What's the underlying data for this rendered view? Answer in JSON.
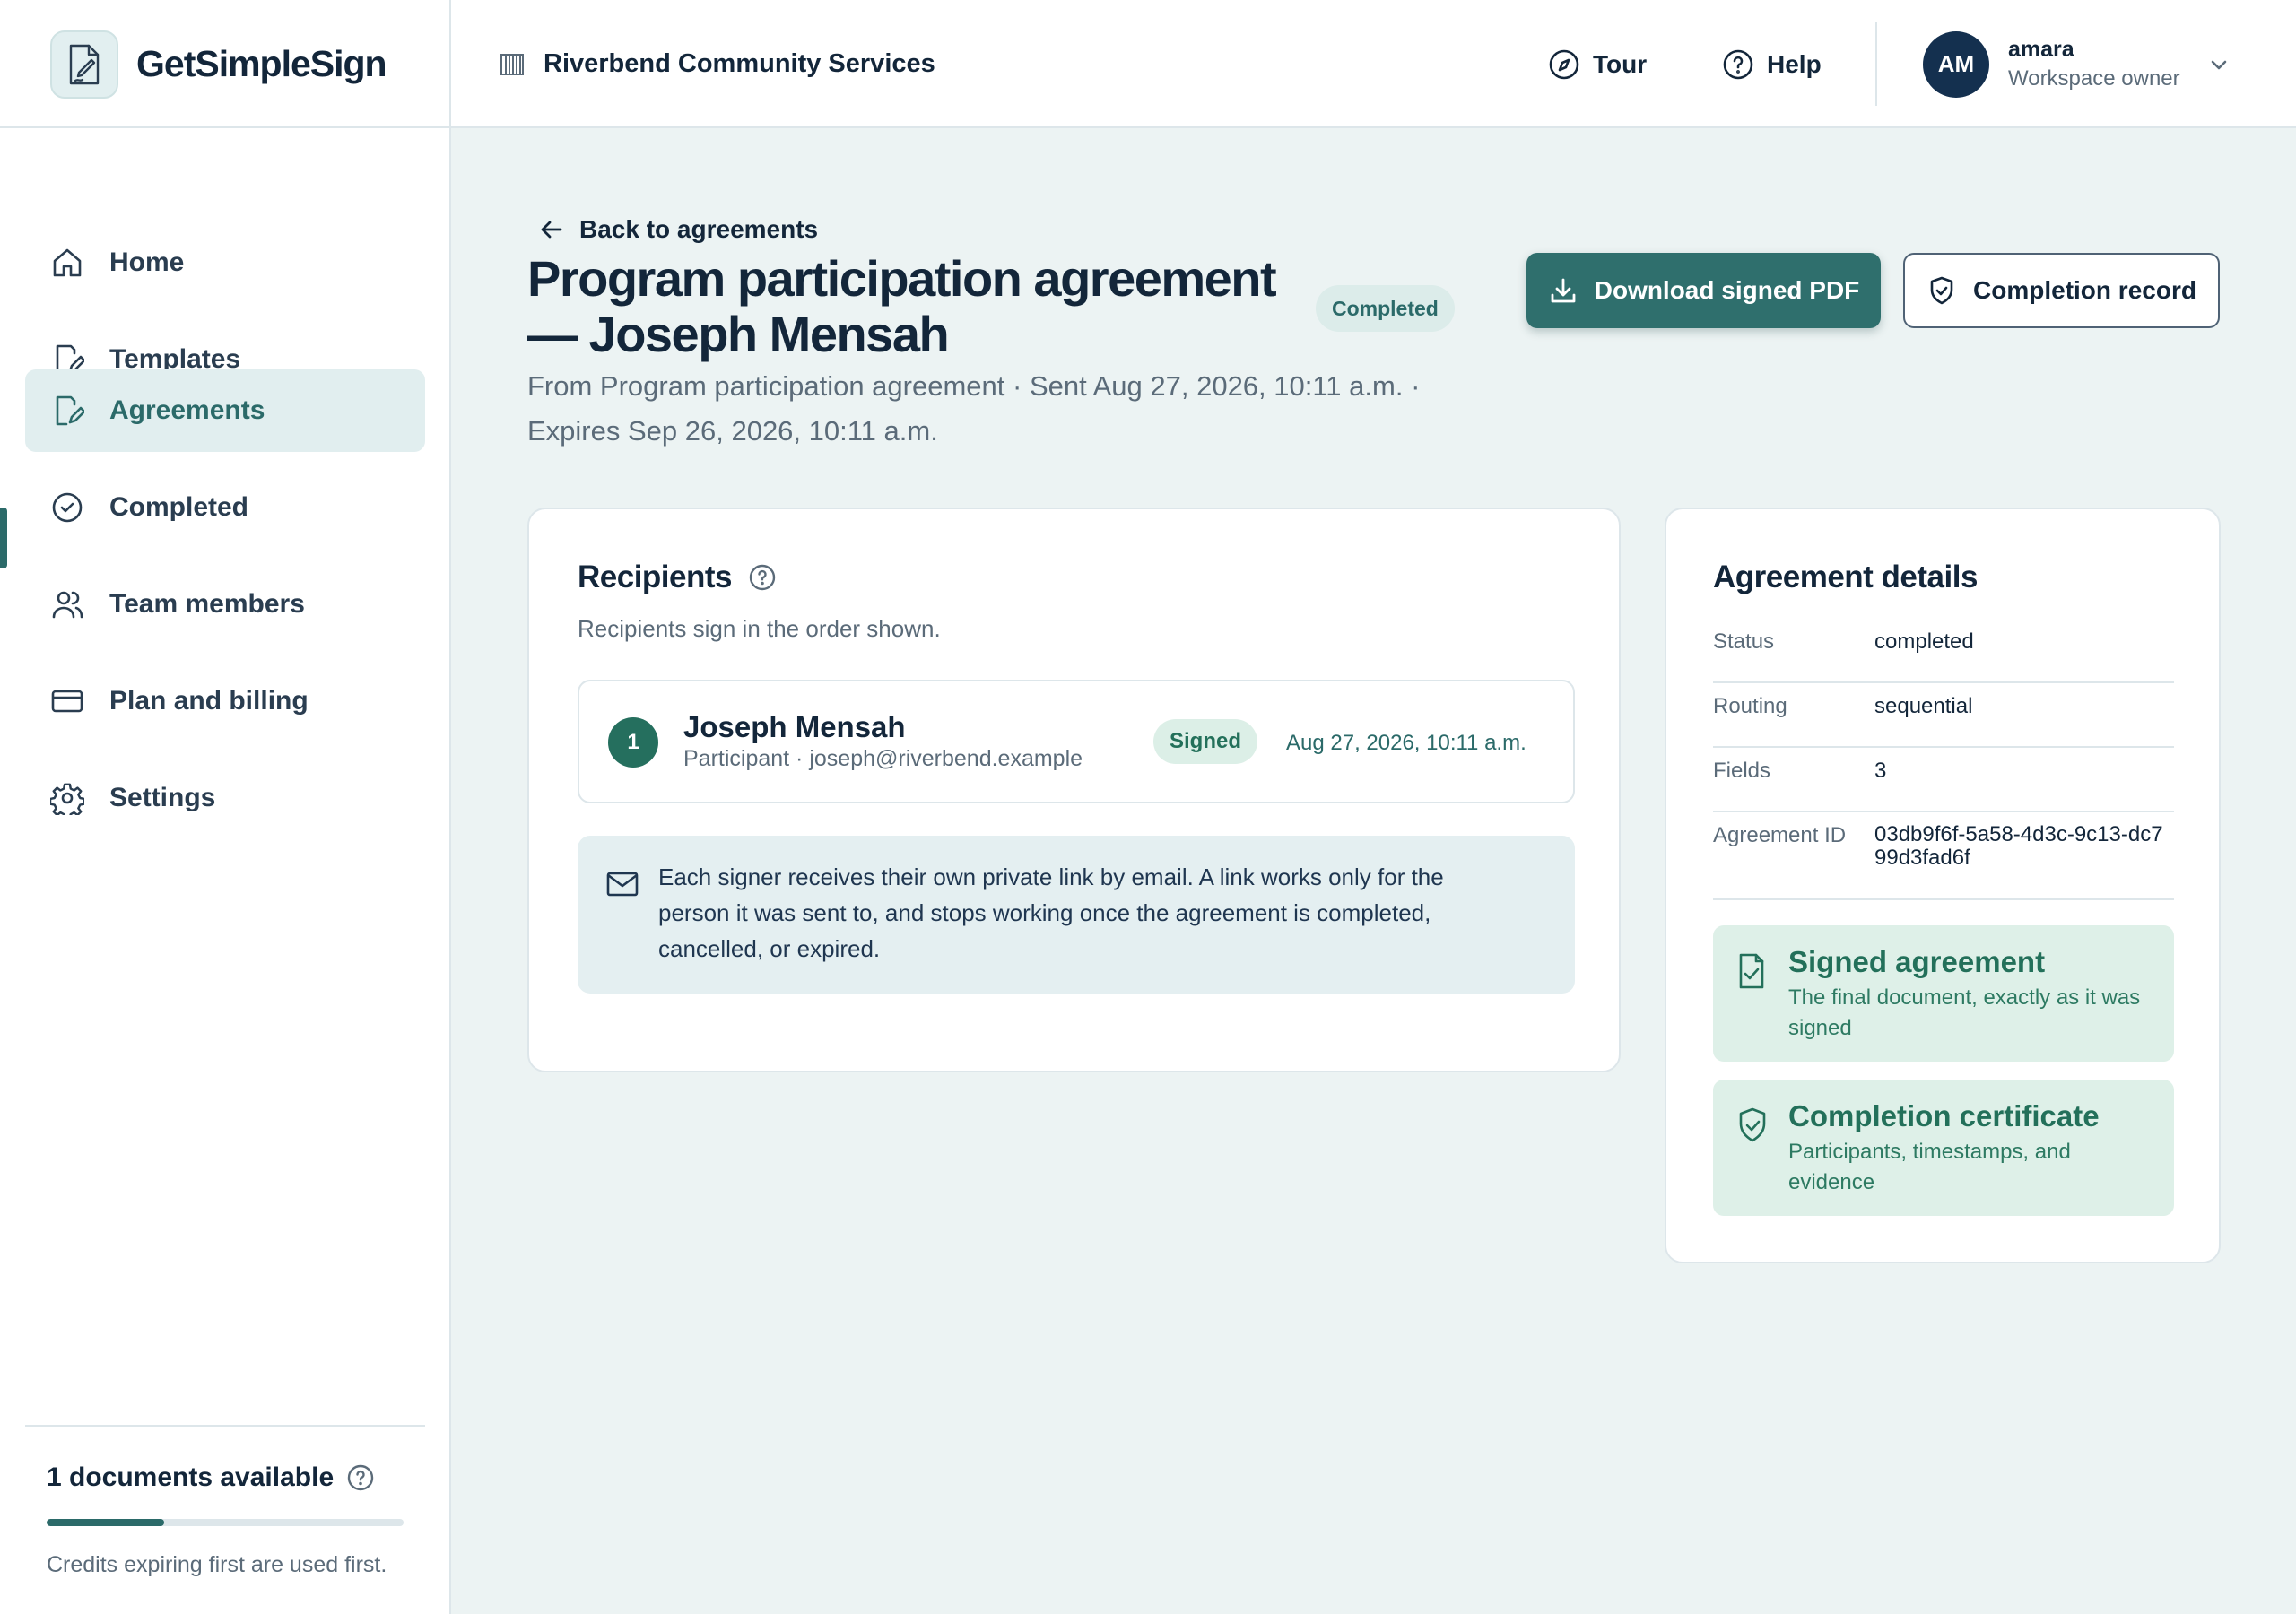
{
  "brand": {
    "name": "GetSimpleSign"
  },
  "org": {
    "name": "Riverbend Community Services"
  },
  "topbar": {
    "tour_label": "Tour",
    "help_label": "Help"
  },
  "user": {
    "initials": "AM",
    "name": "amara",
    "role": "Workspace owner"
  },
  "sidebar": {
    "items": [
      {
        "label": "Home",
        "icon": "home-icon"
      },
      {
        "label": "Templates",
        "icon": "template-icon"
      },
      {
        "label": "Agreements",
        "icon": "agreement-icon",
        "active": true
      },
      {
        "label": "Completed",
        "icon": "check-circle-icon"
      },
      {
        "label": "Team members",
        "icon": "users-icon"
      },
      {
        "label": "Plan and billing",
        "icon": "credit-card-icon"
      },
      {
        "label": "Settings",
        "icon": "gear-icon"
      }
    ]
  },
  "credits": {
    "title": "1 documents available",
    "note": "Credits expiring first are used first.",
    "progress_fraction": 0.33
  },
  "page": {
    "back_label": "Back to agreements",
    "title": "Program participation agreement — Joseph Mensah",
    "status": "Completed",
    "subtitle": "From Program participation agreement · Sent Aug 27, 2026, 10:11 a.m. · Expires Sep 26, 2026, 10:11 a.m.",
    "download_label": "Download signed PDF",
    "record_label": "Completion record"
  },
  "recipients": {
    "title": "Recipients",
    "subtitle": "Recipients sign in the order shown.",
    "list": [
      {
        "order": "1",
        "name": "Joseph Mensah",
        "meta": "Participant · joseph@riverbend.example",
        "status": "Signed",
        "time": "Aug 27, 2026, 10:11 a.m."
      }
    ],
    "info": "Each signer receives their own private link by email. A link works only for the person it was sent to, and stops working once the agreement is completed, cancelled, or expired."
  },
  "details": {
    "title": "Agreement details",
    "rows": [
      {
        "key": "Status",
        "value": "completed"
      },
      {
        "key": "Routing",
        "value": "sequential"
      },
      {
        "key": "Fields",
        "value": "3"
      },
      {
        "key": "Agreement ID",
        "value": "03db9f6f-5a58-4d3c-9c13-dc799d3fad6f"
      }
    ],
    "signed": {
      "title": "Signed agreement",
      "subtitle": "The final document, exactly as it was signed"
    },
    "certificate": {
      "title": "Completion certificate",
      "subtitle": "Participants, timestamps, and evidence"
    }
  },
  "colors": {
    "accent": "#2f6f6d",
    "success": "#23705a",
    "navy": "#14304f",
    "background": "#ecf3f3"
  }
}
